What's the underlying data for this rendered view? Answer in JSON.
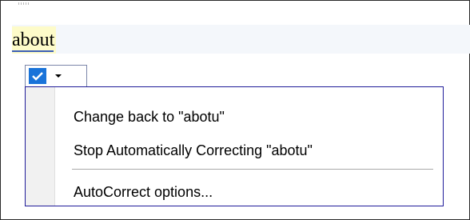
{
  "document": {
    "word": "about"
  },
  "smart_tag": {
    "check_icon": "checkmark-icon",
    "dropdown_icon": "dropdown-arrow-icon"
  },
  "menu": {
    "items": [
      {
        "label": "Change back to \"abotu\""
      },
      {
        "label": "Stop Automatically Correcting \"abotu\""
      },
      {
        "label": "AutoCorrect options..."
      }
    ]
  },
  "colors": {
    "highlight": "#fdfbc9",
    "menu_border": "#1f1b99",
    "check_blue": "#1973d9"
  }
}
